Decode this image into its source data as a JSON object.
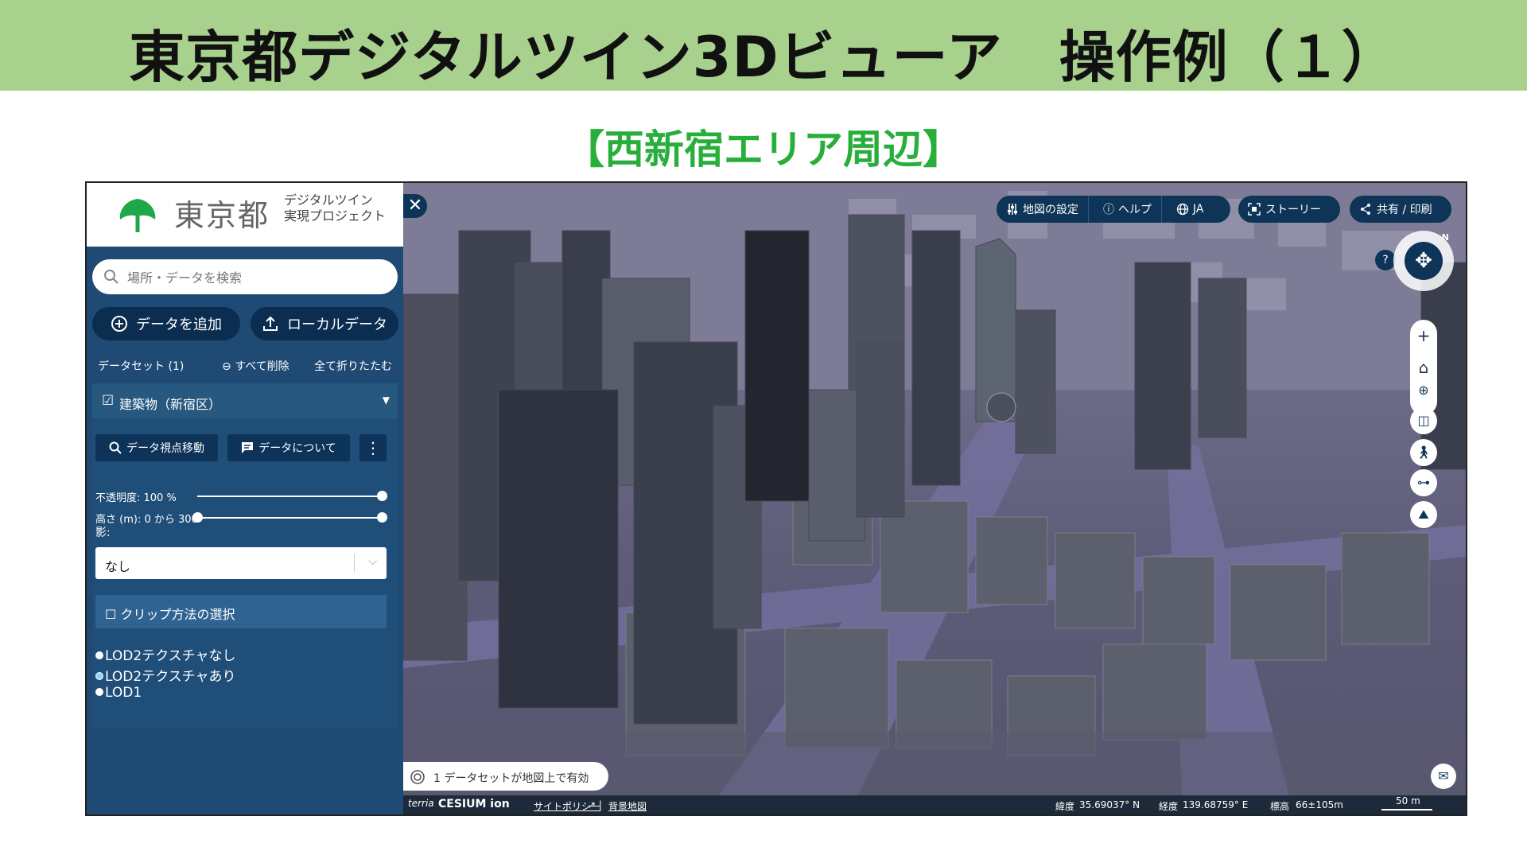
{
  "slide": {
    "title": "東京都デジタルツイン3Dビューア　操作例（１）",
    "subtitle": "【西新宿エリア周辺】"
  },
  "sidebar": {
    "logo_text": "東京都",
    "logo_sub_1": "デジタルツイン",
    "logo_sub_2": "実現プロジェクト",
    "search_placeholder": "場所・データを検索",
    "add_data": "データを追加",
    "local_data": "ローカルデータ",
    "dataset_count": "データセット (1)",
    "delete_all": "すべて削除",
    "collapse_all": "全て折りたたむ",
    "layer_name": "建築物（新宿区）",
    "zoom_to": "データ視点移動",
    "about_data": "データについて",
    "opacity_label": "不透明度: 100 %",
    "height_label": "高さ (m): 0 から 300",
    "opacity_value": 1.0,
    "height_range": [
      0,
      300
    ],
    "shadow_label": "影:",
    "shadow_value": "なし",
    "clip_label": "クリップ方法の選択",
    "styles": [
      {
        "label": "LOD2テクスチャなし",
        "selected": false
      },
      {
        "label": "LOD2テクスチャあり",
        "selected": true
      },
      {
        "label": "LOD1",
        "selected": false
      }
    ]
  },
  "map": {
    "toolbar": {
      "map_settings": "地図の設定",
      "help": "ヘルプ",
      "lang": "JA",
      "story": "ストーリー",
      "share": "共有 / 印刷"
    },
    "compass_n": "N",
    "help_q": "?",
    "status": "1 データセットが地図上で有効",
    "footer": {
      "terria": "terria",
      "cesium": "CESIUM ion",
      "policy": "サイトポリシー",
      "basemap": "背景地図",
      "lat_label": "緯度",
      "lat": "35.69037° N",
      "lon_label": "経度",
      "lon": "139.68759° E",
      "alt_label": "標高",
      "alt": "66±105m",
      "scale": "50 m"
    }
  },
  "colors": {
    "title_bar": "#a9d18e",
    "subtitle": "#27ae3b",
    "sidebar": "#1e4a73",
    "toolbar": "#0e3457"
  }
}
